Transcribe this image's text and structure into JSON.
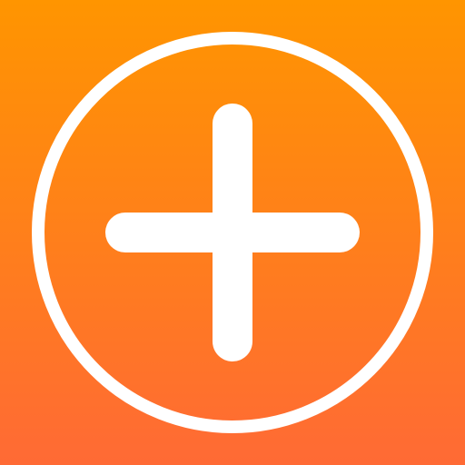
{
  "icon": {
    "name": "add-icon",
    "background_gradient": {
      "top": "#FF9500",
      "bottom": "#FF6A35"
    },
    "foreground_color": "#FFFFFF"
  }
}
